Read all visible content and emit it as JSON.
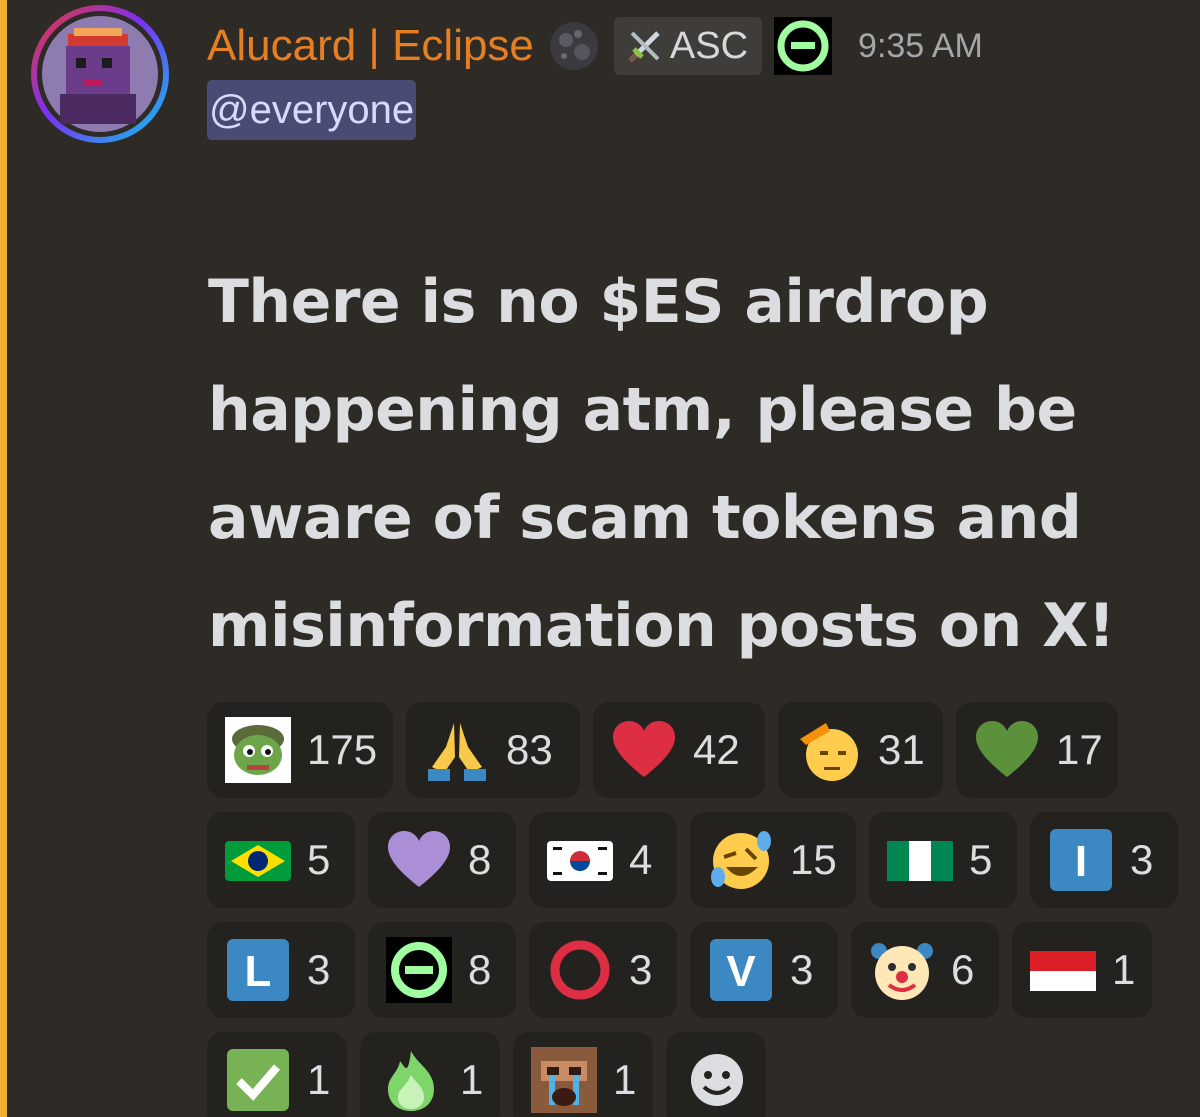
{
  "message": {
    "author": {
      "name": "Alucard | Eclipse",
      "name_color": "#e67e22",
      "avatar": "pixel-purple-character-avatar",
      "badge_icon": "dark-moon-globe-icon",
      "role_tag": {
        "icon": "crossed-swords-icon",
        "label": "ASC"
      },
      "server_badge": "eclipse-logo-icon"
    },
    "timestamp": "9:35 AM",
    "mention": "@everyone",
    "content": "There is no $ES airdrop happening atm, please be aware of scam tokens and misinformation posts on X!",
    "mention_highlight_color": "#f0b132"
  },
  "reactions": [
    {
      "emoji": "pepe-soldier-emoji",
      "count": "175"
    },
    {
      "emoji": "folded-hands-emoji",
      "count": "83"
    },
    {
      "emoji": "red-heart-emoji",
      "count": "42"
    },
    {
      "emoji": "saluting-face-emoji",
      "count": "31"
    },
    {
      "emoji": "green-heart-emoji",
      "count": "17"
    },
    {
      "emoji": "flag-brazil-emoji",
      "count": "5"
    },
    {
      "emoji": "purple-heart-emoji",
      "count": "8"
    },
    {
      "emoji": "flag-south-korea-emoji",
      "count": "4"
    },
    {
      "emoji": "rolling-laughing-emoji",
      "count": "15"
    },
    {
      "emoji": "flag-nigeria-emoji",
      "count": "5"
    },
    {
      "emoji": "regional-letter-i-emoji",
      "count": "3"
    },
    {
      "emoji": "regional-letter-l-emoji",
      "count": "3"
    },
    {
      "emoji": "eclipse-logo-emoji",
      "count": "8"
    },
    {
      "emoji": "hollow-red-circle-emoji",
      "count": "3"
    },
    {
      "emoji": "regional-letter-v-emoji",
      "count": "3"
    },
    {
      "emoji": "clown-face-emoji",
      "count": "6"
    },
    {
      "emoji": "flag-indonesia-emoji",
      "count": "1"
    },
    {
      "emoji": "check-mark-button-emoji",
      "count": "1"
    },
    {
      "emoji": "green-fire-emoji",
      "count": "1"
    },
    {
      "emoji": "crying-man-emoji",
      "count": "1"
    },
    {
      "emoji": "add-reaction-icon",
      "count": ""
    }
  ],
  "icon_letters": {
    "letter_i": "I",
    "letter_l": "L",
    "letter_v": "V"
  }
}
